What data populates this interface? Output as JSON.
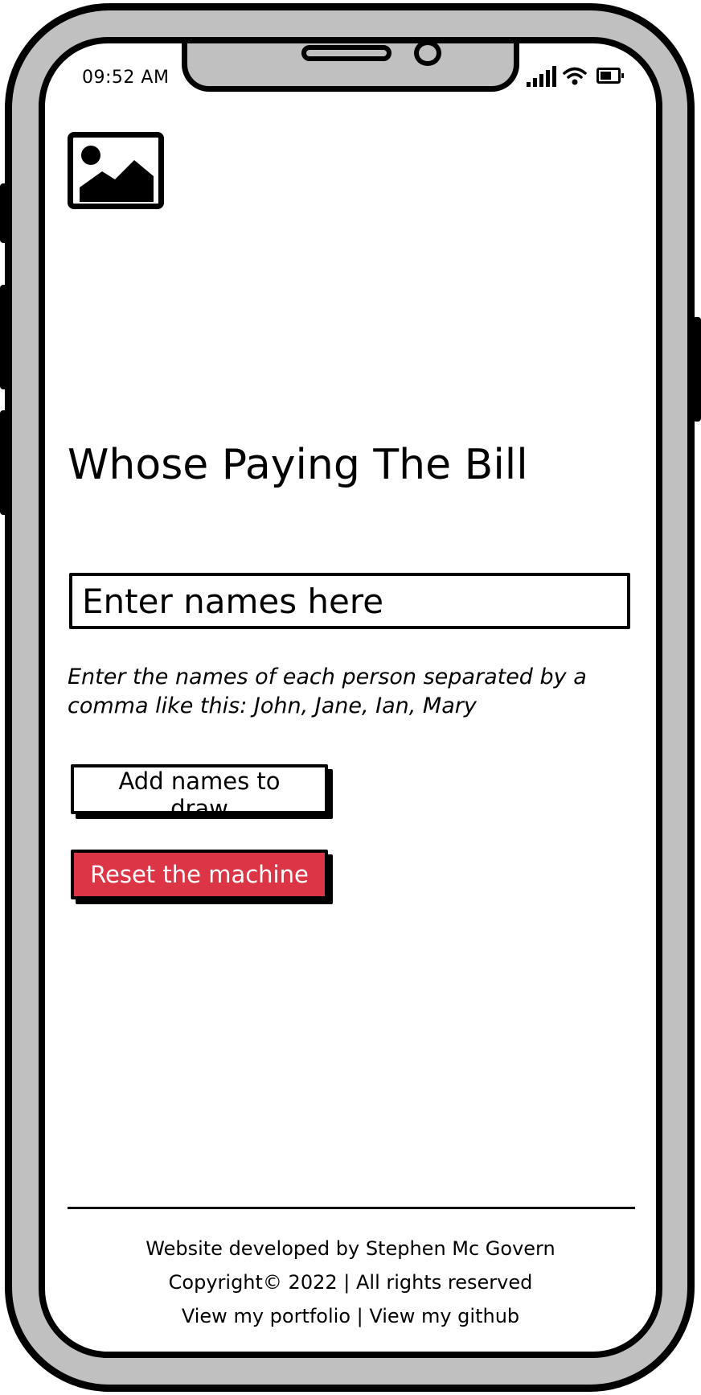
{
  "status_bar": {
    "time": "09:52 AM",
    "icons": [
      "signal-icon",
      "wifi-icon",
      "battery-icon"
    ]
  },
  "header": {
    "logo_icon": "image-placeholder-icon"
  },
  "main": {
    "title": "Whose Paying The Bill",
    "names_input": {
      "placeholder": "Enter names here",
      "value": ""
    },
    "help_text": "Enter the names of each person separated by a comma like this: John, Jane, Ian, Mary",
    "add_button_label": "Add names to draw",
    "reset_button_label": "Reset the machine"
  },
  "footer": {
    "developer_text": "Website developed by Stephen Mc Govern",
    "copyright_text": "Copyright© 2022 | All rights reserved",
    "portfolio_link": "View my portfolio",
    "separator": "|",
    "github_link": "View my github"
  },
  "colors": {
    "frame": "#c0c0c0",
    "reset_button": "#dc3545",
    "text": "#000000"
  }
}
